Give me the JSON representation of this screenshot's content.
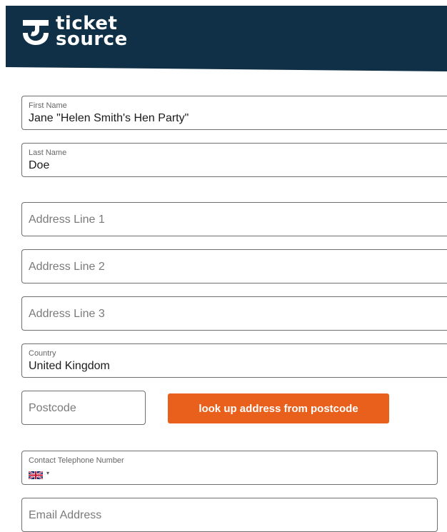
{
  "brand": {
    "line1": "ticket",
    "line2": "source"
  },
  "form": {
    "first_name": {
      "label": "First Name",
      "value": "Jane \"Helen Smith's Hen Party\""
    },
    "last_name": {
      "label": "Last Name",
      "value": "Doe"
    },
    "address_line_1": {
      "placeholder": "Address Line 1"
    },
    "address_line_2": {
      "placeholder": "Address Line 2"
    },
    "address_line_3": {
      "placeholder": "Address Line 3"
    },
    "country": {
      "label": "Country",
      "value": "United Kingdom"
    },
    "postcode": {
      "placeholder": "Postcode"
    },
    "lookup_button": "look up address from postcode",
    "phone": {
      "label": "Contact Telephone Number",
      "flag": "uk-flag-icon",
      "caret": "▾"
    },
    "email": {
      "placeholder": "Email Address"
    }
  },
  "colors": {
    "header": "#0f3046",
    "accent": "#e8601c"
  }
}
